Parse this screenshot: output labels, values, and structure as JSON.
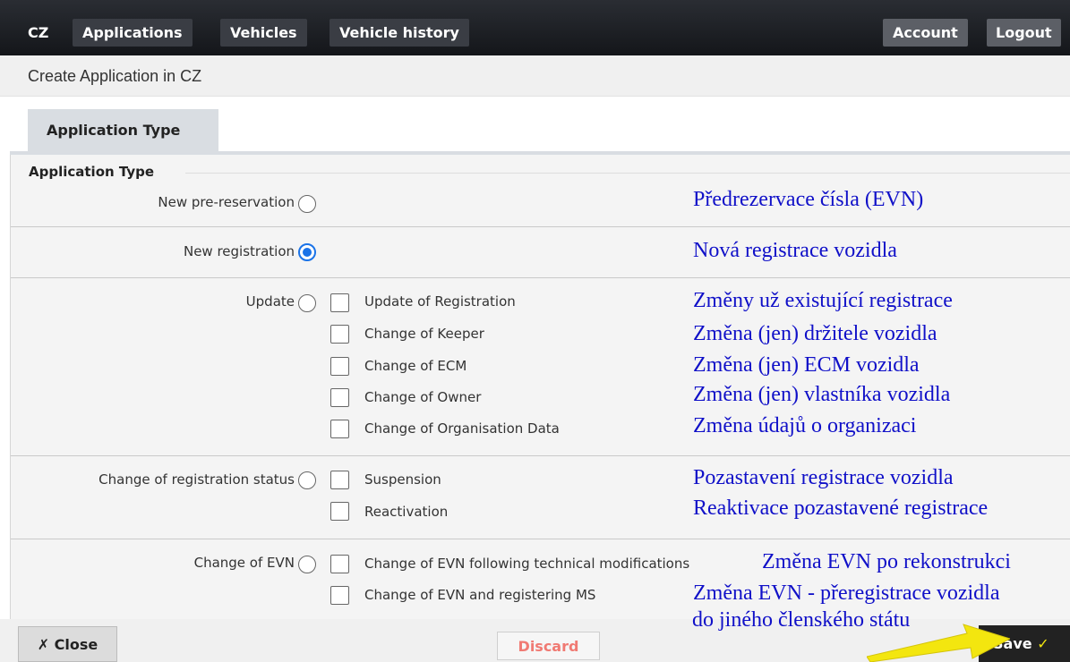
{
  "nav": {
    "cz": "CZ",
    "applications": "Applications",
    "vehicles": "Vehicles",
    "vehicle_history": "Vehicle history",
    "account": "Account",
    "logout": "Logout"
  },
  "page_title": "Create Application in CZ",
  "tab": "Application Type",
  "section_title": "Application Type",
  "groups": {
    "pre_reservation": {
      "label": "New pre-reservation",
      "selected": false,
      "annotation": "Předrezervace čísla (EVN)"
    },
    "new_registration": {
      "label": "New registration",
      "selected": true,
      "annotation": "Nová registrace vozidla"
    },
    "update": {
      "label": "Update",
      "selected": false,
      "options": [
        {
          "label": "Update of Registration",
          "checked": false,
          "annotation": "Změny už existující registrace"
        },
        {
          "label": "Change of Keeper",
          "checked": false,
          "annotation": "Změna (jen) držitele vozidla"
        },
        {
          "label": "Change of ECM",
          "checked": false,
          "annotation": "Změna (jen) ECM vozidla"
        },
        {
          "label": "Change of Owner",
          "checked": false,
          "annotation": "Změna (jen) vlastníka vozidla"
        },
        {
          "label": "Change of Organisation Data",
          "checked": false,
          "annotation": "Změna údajů o organizaci"
        }
      ]
    },
    "status": {
      "label": "Change of registration status",
      "selected": false,
      "options": [
        {
          "label": "Suspension",
          "checked": false,
          "annotation": "Pozastavení registrace vozidla"
        },
        {
          "label": "Reactivation",
          "checked": false,
          "annotation": "Reaktivace pozastavené registrace"
        }
      ]
    },
    "evn": {
      "label": "Change of EVN",
      "selected": false,
      "options": [
        {
          "label": "Change of EVN following technical modifications",
          "checked": false,
          "annotation": "Změna EVN po rekonstrukci"
        },
        {
          "label": "Change of EVN and registering MS",
          "checked": false,
          "annotation": "Změna EVN - přeregistrace vozidla"
        }
      ],
      "annotation_extra": "do jiného členského státu"
    }
  },
  "footer": {
    "close": "✗ Close",
    "discard": "Discard",
    "save": "Save",
    "save_check": "✓"
  },
  "colors": {
    "annotation": "#1010c8",
    "radio_selected": "#1a73e8",
    "discard_text": "#f07a73",
    "arrow": "#f3e60f"
  }
}
